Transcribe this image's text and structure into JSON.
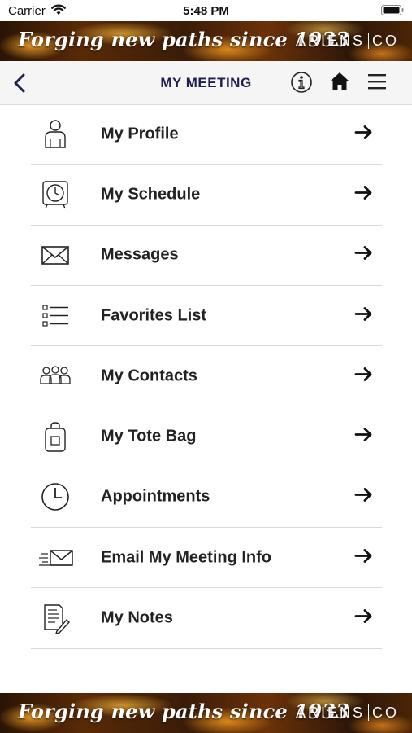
{
  "status_bar": {
    "carrier": "Carrier",
    "time": "5:48 PM"
  },
  "banner": {
    "tagline": "Forging new paths since 1933",
    "brand_left": "ARIENS",
    "brand_right": "CO"
  },
  "nav": {
    "title": "MY MEETING"
  },
  "menu": {
    "items": [
      {
        "label": "My Profile",
        "icon": "person-icon"
      },
      {
        "label": "My Schedule",
        "icon": "alarm-clock-icon"
      },
      {
        "label": "Messages",
        "icon": "envelope-icon"
      },
      {
        "label": "Favorites List",
        "icon": "checklist-icon"
      },
      {
        "label": "My Contacts",
        "icon": "group-icon"
      },
      {
        "label": "My Tote Bag",
        "icon": "tote-bag-icon"
      },
      {
        "label": "Appointments",
        "icon": "clock-icon"
      },
      {
        "label": "Email My Meeting Info",
        "icon": "send-email-icon"
      },
      {
        "label": "My Notes",
        "icon": "notes-icon"
      }
    ]
  },
  "colors": {
    "title": "#1e2150",
    "text": "#222222",
    "divider": "#d9d9d9",
    "nav_bg": "#f5f5f5"
  }
}
